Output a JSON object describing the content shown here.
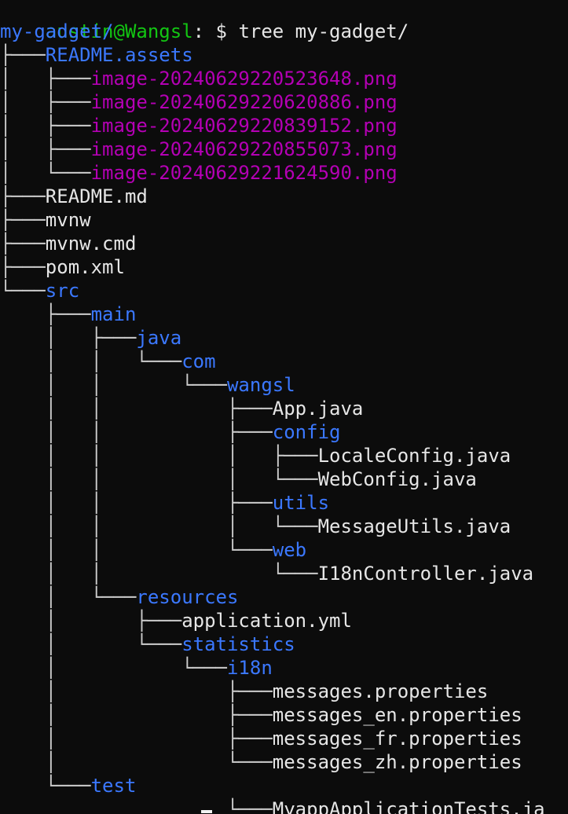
{
  "colors": {
    "background": "#0c0c0c",
    "prompt": "#13c513",
    "default": "#e6e6e6",
    "directory": "#3b78ff",
    "image": "#b400b4"
  },
  "prompt": {
    "user_host": "austin@Wangsl",
    "rest": ": $ tree my-gadget/"
  },
  "tree": [
    {
      "prefix": "",
      "name": "my-gadget/",
      "kind": "dir"
    },
    {
      "prefix": "├───",
      "name": "README.assets",
      "kind": "dir"
    },
    {
      "prefix": "│   ├───",
      "name": "image-20240629220523648.png",
      "kind": "image"
    },
    {
      "prefix": "│   ├───",
      "name": "image-20240629220620886.png",
      "kind": "image"
    },
    {
      "prefix": "│   ├───",
      "name": "image-20240629220839152.png",
      "kind": "image"
    },
    {
      "prefix": "│   ├───",
      "name": "image-20240629220855073.png",
      "kind": "image"
    },
    {
      "prefix": "│   └───",
      "name": "image-20240629221624590.png",
      "kind": "image"
    },
    {
      "prefix": "├───",
      "name": "README.md",
      "kind": "file"
    },
    {
      "prefix": "├───",
      "name": "mvnw",
      "kind": "file"
    },
    {
      "prefix": "├───",
      "name": "mvnw.cmd",
      "kind": "file"
    },
    {
      "prefix": "├───",
      "name": "pom.xml",
      "kind": "file"
    },
    {
      "prefix": "└───",
      "name": "src",
      "kind": "dir"
    },
    {
      "prefix": "    ├───",
      "name": "main",
      "kind": "dir"
    },
    {
      "prefix": "    │   ├───",
      "name": "java",
      "kind": "dir"
    },
    {
      "prefix": "    │   │   └───",
      "name": "com",
      "kind": "dir"
    },
    {
      "prefix": "    │   │       └───",
      "name": "wangsl",
      "kind": "dir"
    },
    {
      "prefix": "    │   │           ├───",
      "name": "App.java",
      "kind": "file"
    },
    {
      "prefix": "    │   │           ├───",
      "name": "config",
      "kind": "dir"
    },
    {
      "prefix": "    │   │           │   ├───",
      "name": "LocaleConfig.java",
      "kind": "file"
    },
    {
      "prefix": "    │   │           │   └───",
      "name": "WebConfig.java",
      "kind": "file"
    },
    {
      "prefix": "    │   │           ├───",
      "name": "utils",
      "kind": "dir"
    },
    {
      "prefix": "    │   │           │   └───",
      "name": "MessageUtils.java",
      "kind": "file"
    },
    {
      "prefix": "    │   │           └───",
      "name": "web",
      "kind": "dir"
    },
    {
      "prefix": "    │   │               └───",
      "name": "I18nController.java",
      "kind": "file"
    },
    {
      "prefix": "    │   └───",
      "name": "resources",
      "kind": "dir"
    },
    {
      "prefix": "    │       ├───",
      "name": "application.yml",
      "kind": "file"
    },
    {
      "prefix": "    │       └───",
      "name": "statistics",
      "kind": "dir"
    },
    {
      "prefix": "    │           └───",
      "name": "i18n",
      "kind": "dir"
    },
    {
      "prefix": "    │               ├───",
      "name": "messages.properties",
      "kind": "file"
    },
    {
      "prefix": "    │               ├───",
      "name": "messages_en.properties",
      "kind": "file"
    },
    {
      "prefix": "    │               ├───",
      "name": "messages_fr.properties",
      "kind": "file"
    },
    {
      "prefix": "    │               └───",
      "name": "messages_zh.properties",
      "kind": "file"
    },
    {
      "prefix": "    └───",
      "name": "test",
      "kind": "dir"
    },
    {
      "prefix": "                    └───",
      "name": "MyappApplicationTests.ja",
      "kind": "file"
    }
  ]
}
